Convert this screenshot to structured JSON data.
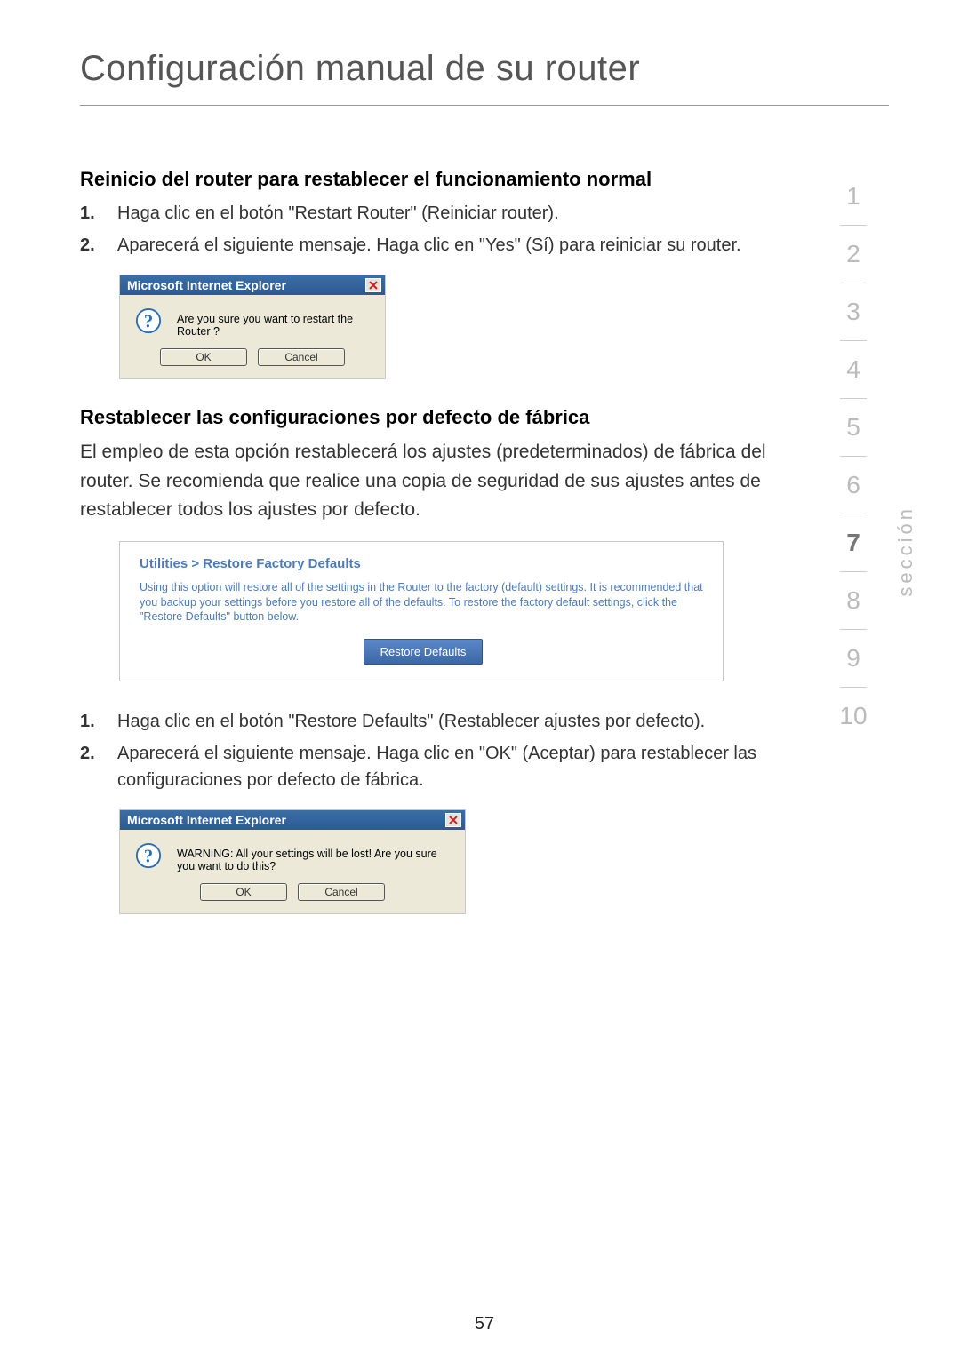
{
  "page": {
    "title": "Configuración manual de su router",
    "number": "57"
  },
  "sidebar": {
    "label": "sección",
    "items": [
      "1",
      "2",
      "3",
      "4",
      "5",
      "6",
      "7",
      "8",
      "9",
      "10"
    ],
    "active": "7"
  },
  "section1": {
    "heading": "Reinicio del router para restablecer el funcionamiento normal",
    "steps": [
      {
        "num": "1.",
        "text": "Haga clic en el botón \"Restart Router\" (Reiniciar router)."
      },
      {
        "num": "2.",
        "text": "Aparecerá el siguiente mensaje. Haga clic en \"Yes\" (Sí) para reiniciar su router."
      }
    ]
  },
  "dialog1": {
    "titlebar": "Microsoft Internet Explorer",
    "message": "Are you sure you want to restart the Router ?",
    "ok": "OK",
    "cancel": "Cancel"
  },
  "section2": {
    "heading": "Restablecer las configuraciones por defecto de fábrica",
    "body": "El empleo de esta opción restablecerá los ajustes (predeterminados) de fábrica del router. Se recomienda que realice una copia de seguridad de sus ajustes antes de restablecer todos los ajustes por defecto.",
    "steps": [
      {
        "num": "1.",
        "text": "Haga clic en el botón \"Restore Defaults\" (Restablecer ajustes por defecto)."
      },
      {
        "num": "2.",
        "text": "Aparecerá el siguiente mensaje. Haga clic en \"OK\" (Aceptar) para restablecer las configuraciones por defecto de fábrica."
      }
    ]
  },
  "admin_panel": {
    "breadcrumb": "Utilities > Restore Factory Defaults",
    "text": "Using this option will restore all of the settings in the Router to the factory (default) settings. It is recommended that you backup your settings before you restore all of the defaults. To restore the factory default settings, click the \"Restore Defaults\" button below.",
    "button": "Restore Defaults"
  },
  "dialog2": {
    "titlebar": "Microsoft Internet Explorer",
    "message": "WARNING: All your settings will be lost! Are you sure you want to do this?",
    "ok": "OK",
    "cancel": "Cancel"
  }
}
